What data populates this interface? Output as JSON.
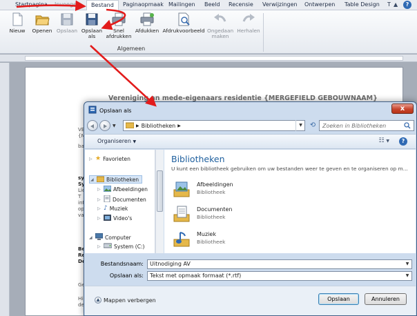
{
  "ribbon": {
    "tabs": [
      "Startpagina",
      "Invoegen",
      "Bestand",
      "Paginaopmaak",
      "Mailingen",
      "Beeld",
      "Recensie",
      "Verwijzingen",
      "Ontwerpen",
      "Table Design",
      "T"
    ],
    "active_tab": "Bestand",
    "buttons": {
      "new": "Nieuw",
      "open": "Openen",
      "save": "Opslaan",
      "save_as_line1": "Opslaan",
      "save_as_line2": "als",
      "quick_print_line1": "Snel",
      "quick_print_line2": "afdrukken",
      "print": "Afdukken",
      "print_preview": "Afdrukvoorbeeld",
      "undo_line1": "Ongedaan",
      "undo_line2": "maken",
      "redo": "Herhalen"
    },
    "group_label": "Algemeen"
  },
  "document": {
    "heading_left": "Vereniging",
    "heading_right": "an mede-eigenaars residentie {MERGEFIELD GEBOUWNAAM}",
    "lines": [
      "VE",
      "{M",
      "ba",
      "sy",
      "Sy",
      "Lie",
      "T",
      "inf",
      "op",
      "va",
      "Be",
      "Re",
      "De",
      "Ge",
      "Hi",
      "de"
    ]
  },
  "dialog": {
    "title": "Opslaan als",
    "close_glyph": "x",
    "address": "Bibliotheken",
    "search_placeholder": "Zoeken in Bibliotheken",
    "organize": "Organiseren",
    "nav": {
      "favorites": "Favorieten",
      "libraries": "Bibliotheken",
      "pictures": "Afbeeldingen",
      "documents": "Documenten",
      "music": "Muziek",
      "videos": "Video's",
      "computer": "Computer",
      "system_drive": "System (C:)"
    },
    "content": {
      "title": "Bibliotheken",
      "description": "U kunt een bibliotheek gebruiken om uw bestanden weer te geven en te organiseren op m...",
      "items": [
        {
          "name": "Afbeeldingen",
          "type": "Bibliotheek",
          "icon": "pictures-library-icon"
        },
        {
          "name": "Documenten",
          "type": "Bibliotheek",
          "icon": "documents-library-icon"
        },
        {
          "name": "Muziek",
          "type": "Bibliotheek",
          "icon": "music-library-icon"
        }
      ]
    },
    "filename_label": "Bestandsnaam:",
    "filename_value": "Uitnodiging AV",
    "filetype_label": "Opslaan als:",
    "filetype_value": "Tekst met opmaak formaat (*.rtf)",
    "hide_folders": "Mappen verbergen",
    "save_button": "Opslaan",
    "cancel_button": "Annuleren"
  },
  "colors": {
    "accent_arrow": "#e21b1b",
    "link_title": "#1e5f9e",
    "close_red": "#c8462e"
  }
}
